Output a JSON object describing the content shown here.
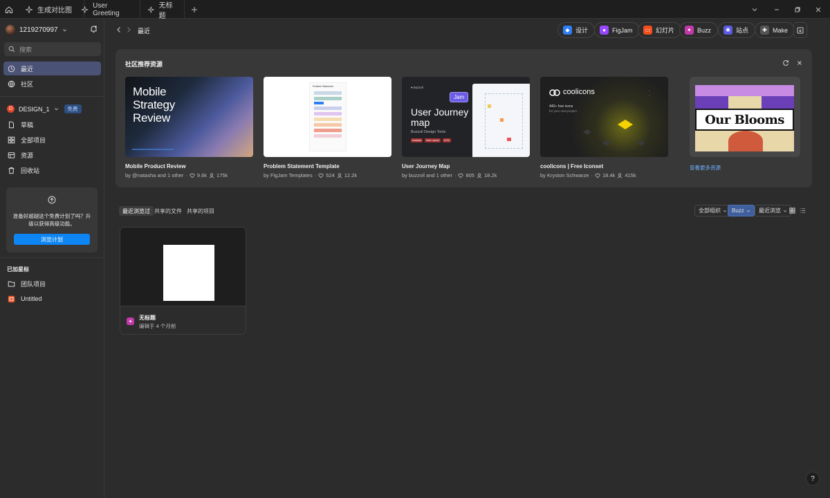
{
  "tabs": [
    {
      "label": "生成对比图"
    },
    {
      "label": "User Greeting"
    },
    {
      "label": "无标题"
    }
  ],
  "sidebar": {
    "user": "1219270997",
    "search_placeholder": "搜索",
    "nav": [
      {
        "label": "最近"
      },
      {
        "label": "社区"
      }
    ],
    "team": {
      "name": "DESIGN_1",
      "badge": "免费",
      "initial": "D"
    },
    "team_items": [
      {
        "label": "草稿"
      },
      {
        "label": "全部项目"
      },
      {
        "label": "资源"
      },
      {
        "label": "回收站"
      }
    ],
    "upgrade": {
      "text": "准备好超越这个免费计划了吗？升级以获得高级功能。",
      "button": "浏览计划"
    },
    "starred_heading": "已加星标",
    "starred": [
      {
        "label": "团队项目"
      },
      {
        "label": "Untitled"
      }
    ]
  },
  "header": {
    "breadcrumb": "最近",
    "create_buttons": [
      {
        "label": "设计",
        "color": "#2d7ff9",
        "icon": "design-icon"
      },
      {
        "label": "FigJam",
        "color": "#9747ff",
        "icon": "figjam-icon"
      },
      {
        "label": "幻灯片",
        "color": "#f24e1e",
        "icon": "slides-icon"
      },
      {
        "label": "Buzz",
        "color": "#c23aaa",
        "icon": "buzz-icon"
      },
      {
        "label": "站点",
        "color": "#5b5ce2",
        "icon": "sites-icon"
      },
      {
        "label": "Make",
        "color": "#444444",
        "icon": "make-icon"
      }
    ]
  },
  "community": {
    "title": "社区推荐资源",
    "more_link": "查看更多资源",
    "cards": [
      {
        "title": "Mobile Product Review",
        "author": "by @natasha and 1 other",
        "likes": "9.6k",
        "users": "175k",
        "thumb_text": [
          "Mobile",
          "Strategy",
          "Review"
        ]
      },
      {
        "title": "Problem Statement Template",
        "author": "by FigJam Templates",
        "likes": "524",
        "users": "12.2k",
        "thumb_text": [
          "Problem Statement"
        ]
      },
      {
        "title": "User Journey Map",
        "author": "by buzzvil and 1 other",
        "likes": "805",
        "users": "18.2k",
        "thumb_text": [
          "User Journey",
          "map",
          "Buzzvil Design Tools",
          "Jam",
          "Analysis",
          "Kato Layout",
          "UCM"
        ]
      },
      {
        "title": "coolicons | Free Iconset",
        "author": "by Kryston Schwarze",
        "likes": "18.4k",
        "users": "415k",
        "thumb_text": [
          "coolicons",
          "440+ free icons",
          "for your next project"
        ]
      }
    ],
    "promo_text": "Our Blooms"
  },
  "files": {
    "filters": [
      "最近浏览过",
      "共享的文件",
      "共享的项目"
    ],
    "org_select": "全部组织",
    "type_select": "Buzz",
    "sort_select": "最近浏览",
    "items": [
      {
        "name": "无标题",
        "edited": "编辑于 4 个月前"
      }
    ]
  },
  "help_label": "?"
}
